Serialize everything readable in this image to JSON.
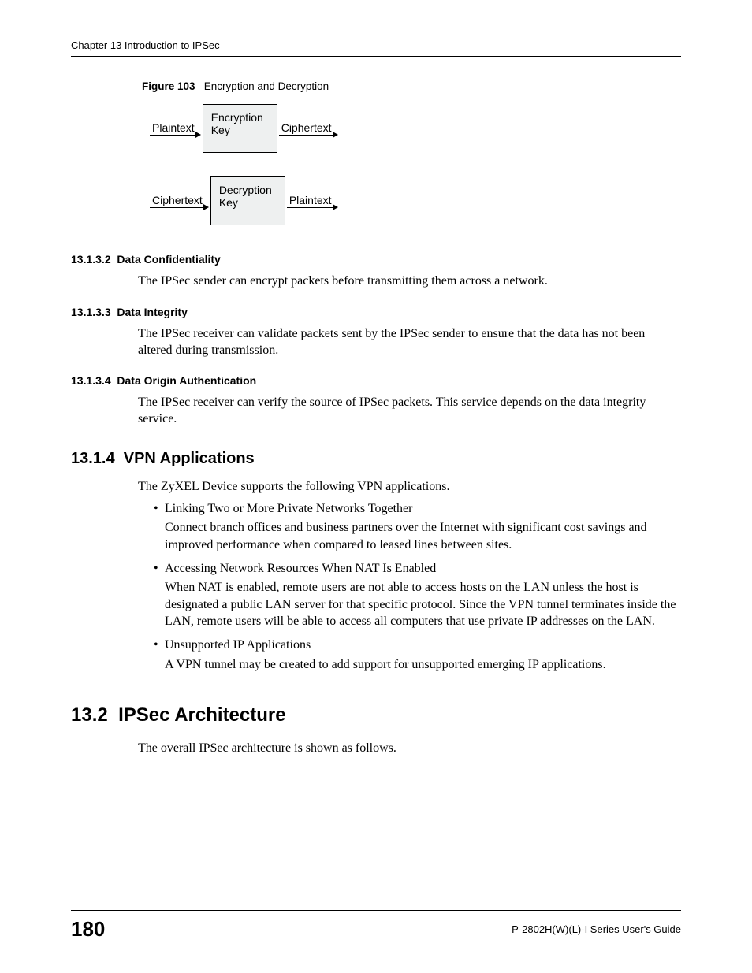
{
  "header": {
    "chapter_title": "Chapter 13 Introduction to IPSec"
  },
  "figure": {
    "label": "Figure 103",
    "title": "Encryption and Decryption",
    "row1": {
      "left": "Plaintext",
      "box": "Encryption Key",
      "right": "Ciphertext"
    },
    "row2": {
      "left": "Ciphertext",
      "box": "Decryption Key",
      "right": "Plaintext"
    }
  },
  "sections": {
    "s1": {
      "number": "13.1.3.2",
      "title": "Data Confidentiality",
      "body": "The IPSec sender can encrypt packets before transmitting them across a network."
    },
    "s2": {
      "number": "13.1.3.3",
      "title": "Data Integrity",
      "body": "The IPSec receiver can validate packets sent by the IPSec sender to ensure that the data has not been altered during transmission."
    },
    "s3": {
      "number": "13.1.3.4",
      "title": "Data Origin Authentication",
      "body": "The IPSec receiver can verify the source of IPSec packets. This service depends on the data integrity service."
    },
    "s4": {
      "number": "13.1.4",
      "title": "VPN Applications",
      "intro": "The ZyXEL Device supports the following VPN applications.",
      "bullets": [
        {
          "head": "Linking Two or More Private Networks Together",
          "detail": "Connect branch offices and business partners over the Internet with significant cost savings and improved performance when compared to leased lines between sites."
        },
        {
          "head": "Accessing Network Resources When NAT Is Enabled",
          "detail": "When NAT is enabled, remote users are not able to access hosts on the LAN unless the host is designated a public LAN server for that specific protocol. Since the VPN tunnel terminates inside the LAN, remote users will be able to access all computers that use private IP addresses on the LAN."
        },
        {
          "head": "Unsupported IP Applications",
          "detail": "A VPN tunnel may be created to add support for unsupported emerging IP applications."
        }
      ]
    },
    "s5": {
      "number": "13.2",
      "title": "IPSec Architecture",
      "intro": "The overall IPSec architecture is shown as follows."
    }
  },
  "footer": {
    "page": "180",
    "guide": "P-2802H(W)(L)-I Series User's Guide"
  }
}
